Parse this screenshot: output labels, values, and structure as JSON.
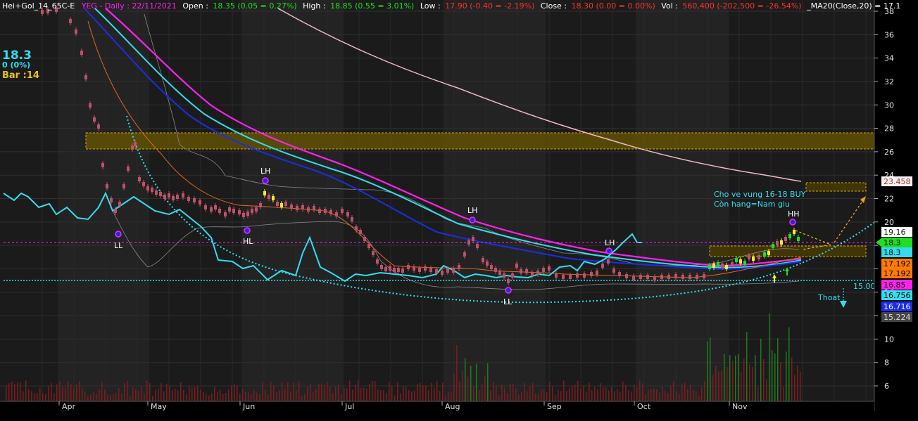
{
  "header": {
    "symbol": "Hei+Gol_14_65C-E",
    "ticker": "YEG - Daily : 22/11/2021",
    "open_label": "Open :",
    "open_value": "18.35 (0.05 = 0.27%)",
    "high_label": "High :",
    "high_value": "18.85 (0.55 = 3.01%)",
    "low_label": "Low :",
    "low_value": "17.90 (-0.40 = -2.19%)",
    "close_label": "Close :",
    "close_value": "18.30 (0.00 = 0.00%)",
    "vol_label": "Vol :",
    "vol_value": "560,400 (-202,500 = -26.54%)",
    "ma_label": "_MA20(Close,20) = 17.1"
  },
  "info": {
    "price": "18.3",
    "change": "0 (0%)",
    "bar": "Bar :14"
  },
  "annotations": {
    "ll1": "LL",
    "hl": "HL",
    "lh1": "LH",
    "lh2": "LH",
    "ll2": "LL",
    "lh3": "LH",
    "hh": "HH",
    "note_line1": "Cho ve vung 16-18 BUY",
    "note_line2": "Còn hang=Nam giu",
    "support_value": "15.00",
    "exit_label": "Thoat"
  },
  "colors": {
    "background": "#000000",
    "panel": "#1e1e1e",
    "grid": "#2c2c2c",
    "candle": "#c0506a",
    "cyan": "#33ddee",
    "magenta": "#ff22ee",
    "blue": "#1a2ee6",
    "pink_ma": "#f0b8c8",
    "orange": "#e06a20",
    "zone": "#d4a800",
    "volume": "#7b1c1c",
    "volume_up": "#1f7a1f"
  },
  "price_axis": {
    "ticks": [
      "38",
      "36",
      "34",
      "32",
      "30",
      "28",
      "26",
      "24",
      "22",
      "20",
      "18",
      "16",
      "14",
      "12",
      "10",
      "8",
      "6"
    ],
    "tags": [
      {
        "text": "23.458",
        "bg": "#f2f2f2",
        "fg": "#b03030"
      },
      {
        "text": "19.16",
        "bg": "#ffffff",
        "fg": "#222222"
      },
      {
        "text": "18.3",
        "bg": "#22dd22",
        "fg": "#000000"
      },
      {
        "text": "18.3",
        "bg": "#33ddee",
        "fg": "#000000"
      },
      {
        "text": "17.192",
        "bg": "#ff7a00",
        "fg": "#000000"
      },
      {
        "text": "17.192",
        "bg": "#ff7a00",
        "fg": "#000000"
      },
      {
        "text": "16.85",
        "bg": "#ff22ee",
        "fg": "#000000"
      },
      {
        "text": "16.756",
        "bg": "#33ddee",
        "fg": "#000000"
      },
      {
        "text": "16.716",
        "bg": "#1a2ee6",
        "fg": "#ffffff"
      },
      {
        "text": "15.224",
        "bg": "#444444",
        "fg": "#dddddd"
      }
    ]
  },
  "time_axis": {
    "labels": [
      "Apr",
      "May",
      "Jun",
      "Jul",
      "Aug",
      "Sep",
      "Oct",
      "Nov"
    ]
  }
}
